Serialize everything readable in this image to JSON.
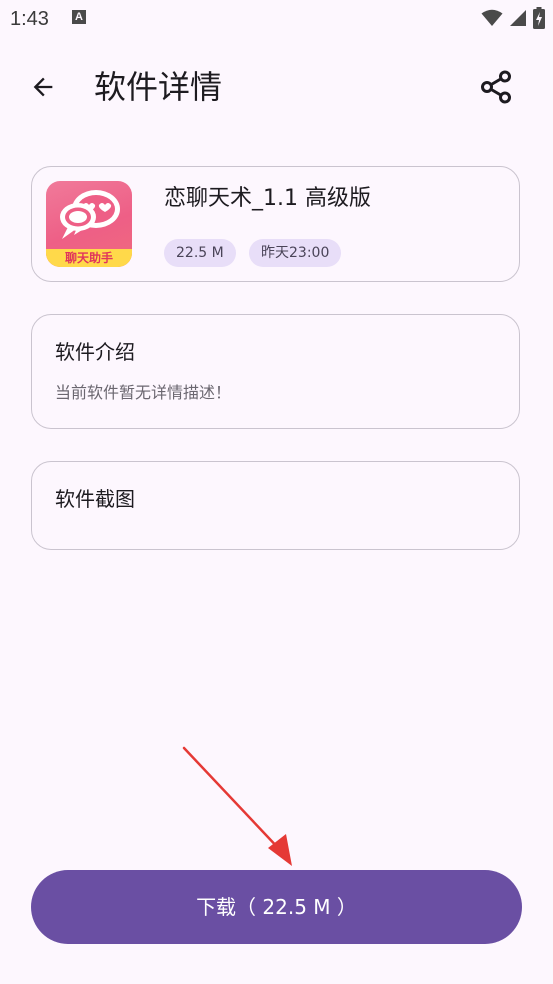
{
  "status_bar": {
    "time": "1:43",
    "notification_icon": "A"
  },
  "app_bar": {
    "title": "软件详情",
    "back_icon": "arrow-left-icon",
    "share_icon": "share-icon"
  },
  "app": {
    "name": "恋聊天术_1.1 高级版",
    "icon_label": "聊天助手",
    "size": "22.5 M",
    "date": "昨天23:00"
  },
  "intro": {
    "title": "软件介绍",
    "description": "当前软件暂无详情描述！"
  },
  "screenshots": {
    "title": "软件截图"
  },
  "download": {
    "label": "下载（ 22.5 M ）"
  },
  "colors": {
    "background": "#fdf7fe",
    "primary": "#6a4fa3",
    "chip": "#e8def8",
    "annotation": "#e53935"
  }
}
